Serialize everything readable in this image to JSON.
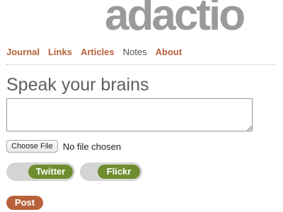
{
  "site": {
    "logo_text": "adactio"
  },
  "nav": {
    "items": [
      {
        "label": "Journal",
        "current": false
      },
      {
        "label": "Links",
        "current": false
      },
      {
        "label": "Articles",
        "current": false
      },
      {
        "label": "Notes",
        "current": true
      },
      {
        "label": "About",
        "current": false
      }
    ]
  },
  "form": {
    "heading": "Speak your brains",
    "textarea_value": "",
    "file": {
      "button_label": "Choose File",
      "status": "No file chosen"
    },
    "toggles": [
      {
        "label": "Twitter",
        "on": true
      },
      {
        "label": "Flickr",
        "on": true
      }
    ],
    "submit_label": "Post"
  },
  "colors": {
    "logo": "#9a9a9a",
    "nav_link": "#b8613a",
    "nav_current": "#555555",
    "toggle_on": "#6d8d2f",
    "toggle_track": "#d4d4d4",
    "post_button": "#b8613a"
  }
}
